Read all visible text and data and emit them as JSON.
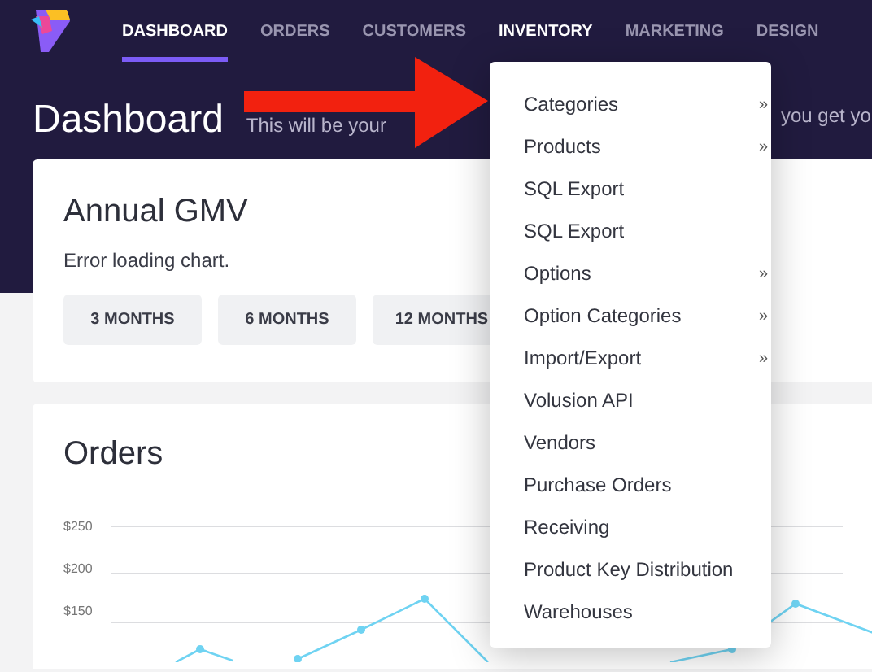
{
  "nav": {
    "items": [
      {
        "label": "DASHBOARD",
        "selected": true
      },
      {
        "label": "ORDERS",
        "selected": false
      },
      {
        "label": "CUSTOMERS",
        "selected": false
      },
      {
        "label": "INVENTORY",
        "selected": false,
        "open": true
      },
      {
        "label": "MARKETING",
        "selected": false
      },
      {
        "label": "DESIGN",
        "selected": false
      }
    ]
  },
  "header": {
    "title": "Dashboard",
    "subtitle_start": "This will be your",
    "subtitle_end": "you get yo"
  },
  "gmv_card": {
    "title": "Annual GMV",
    "message": "Error loading chart.",
    "buttons": [
      "3 MONTHS",
      "6 MONTHS",
      "12 MONTHS"
    ]
  },
  "orders_card": {
    "title": "Orders",
    "y_labels": [
      "$250",
      "$200",
      "$150"
    ]
  },
  "inventory_menu": {
    "items": [
      {
        "label": "Categories",
        "submenu": true
      },
      {
        "label": "Products",
        "submenu": true
      },
      {
        "label": "SQL Export",
        "submenu": false
      },
      {
        "label": "SQL Export",
        "submenu": false
      },
      {
        "label": "Options",
        "submenu": true
      },
      {
        "label": "Option Categories",
        "submenu": true
      },
      {
        "label": "Import/Export",
        "submenu": true
      },
      {
        "label": "Volusion API",
        "submenu": false
      },
      {
        "label": "Vendors",
        "submenu": false
      },
      {
        "label": "Purchase Orders",
        "submenu": false
      },
      {
        "label": "Receiving",
        "submenu": false
      },
      {
        "label": "Product Key Distribution",
        "submenu": false
      },
      {
        "label": "Warehouses",
        "submenu": false
      }
    ],
    "submenu_mark": "»"
  }
}
